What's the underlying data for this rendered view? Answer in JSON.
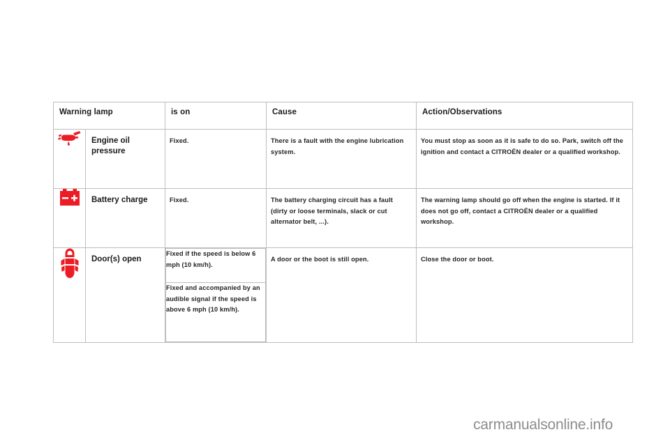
{
  "colors": {
    "icon_red": "#ED1C24",
    "header_bg": "#e3e3e3",
    "label_bg": "#ececec",
    "border": "#bdbdbd",
    "text": "#231f20",
    "watermark": "#8c8c8c"
  },
  "table": {
    "headers": [
      "Warning lamp",
      "is on",
      "Cause",
      "Action/Observations"
    ],
    "rows": [
      {
        "icon": "engine-oil-pressure-icon",
        "label": "Engine oil pressure",
        "is_on": "Fixed.",
        "cause": "There is a fault with the engine lubrication system.",
        "action": "You must stop as soon as it is safe to do so. Park, switch off the ignition and contact a CITROËN dealer or a qualified workshop."
      },
      {
        "icon": "battery-charge-icon",
        "label": "Battery charge",
        "is_on": "Fixed.",
        "cause": "The battery charging circuit has a fault (dirty or loose terminals, slack or cut alternator belt, ...).",
        "action": "The warning lamp should go off when the engine is started. If it does not go off, contact a CITROËN dealer or a qualified workshop."
      },
      {
        "icon": "doors-open-icon",
        "label": "Door(s) open",
        "is_on_top": "Fixed if the speed is below 6 mph (10 km/h).",
        "is_on_bottom": "Fixed and accompanied by an audible signal if the speed is above 6 mph (10 km/h).",
        "cause_top": "",
        "cause": "A door or the boot is still open.",
        "action_top": "",
        "action": "Close the door or boot."
      }
    ]
  },
  "watermark": {
    "text": "carmanualsonline.info"
  }
}
